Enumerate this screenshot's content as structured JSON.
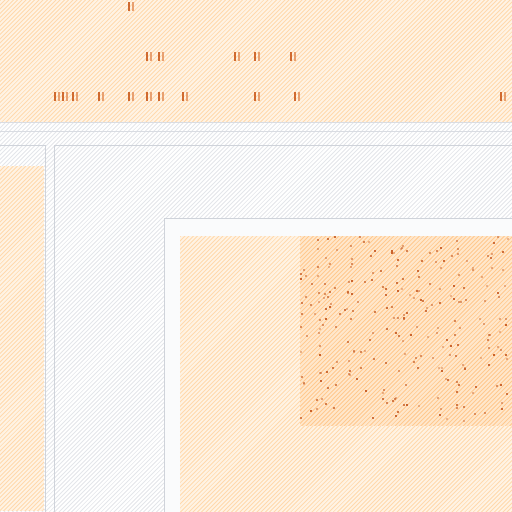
{
  "top_pane": {
    "description_label": "",
    "row_markers": [
      {
        "row": 0,
        "cols": [
          128
        ]
      },
      {
        "row": 5,
        "cols": [
          146,
          158,
          234,
          254,
          290
        ]
      },
      {
        "row": 9,
        "cols": [
          54,
          62,
          72,
          98,
          128,
          146,
          158,
          182,
          254,
          294,
          500
        ]
      }
    ]
  },
  "left_panel": {
    "label": ""
  },
  "center_panel": {
    "label": ""
  },
  "inner_panel": {
    "label": ""
  },
  "colors": {
    "accent": "#d06a30",
    "highlight_bg": "#fff3e4",
    "highlight_stripe": "#ffd9ad",
    "neutral_stripe": "#e4e6ea",
    "border": "#cfd3da"
  }
}
